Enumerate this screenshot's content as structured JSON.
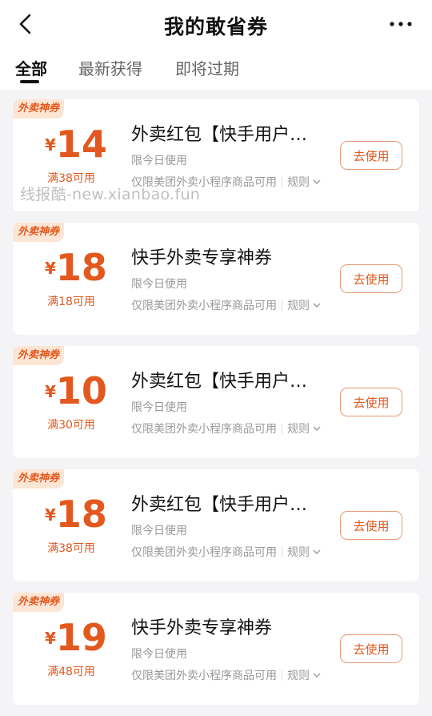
{
  "header": {
    "title": "我的敢省券"
  },
  "tabs": [
    {
      "label": "全部",
      "active": true
    },
    {
      "label": "最新获得",
      "active": false
    },
    {
      "label": "即将过期",
      "active": false
    }
  ],
  "coupons": [
    {
      "tag": "外卖神券",
      "currency": "¥",
      "amount": "14",
      "condition": "满38可用",
      "title": "外卖红包【快手用户专享】",
      "validity": "限今日使用",
      "scope": "仅限美团外卖小程序商品可用",
      "rule_label": "规则",
      "button": "去使用"
    },
    {
      "tag": "外卖神券",
      "currency": "¥",
      "amount": "18",
      "condition": "满18可用",
      "title": "快手外卖专享神券",
      "validity": "限今日使用",
      "scope": "仅限美团外卖小程序商品可用",
      "rule_label": "规则",
      "button": "去使用"
    },
    {
      "tag": "外卖神券",
      "currency": "¥",
      "amount": "10",
      "condition": "满30可用",
      "title": "外卖红包【快手用户专享】",
      "validity": "限今日使用",
      "scope": "仅限美团外卖小程序商品可用",
      "rule_label": "规则",
      "button": "去使用"
    },
    {
      "tag": "外卖神券",
      "currency": "¥",
      "amount": "18",
      "condition": "满38可用",
      "title": "外卖红包【快手用户专享】",
      "validity": "限今日使用",
      "scope": "仅限美团外卖小程序商品可用",
      "rule_label": "规则",
      "button": "去使用"
    },
    {
      "tag": "外卖神券",
      "currency": "¥",
      "amount": "19",
      "condition": "满48可用",
      "title": "快手外卖专享神券",
      "validity": "限今日使用",
      "scope": "仅限美团外卖小程序商品可用",
      "rule_label": "规则",
      "button": "去使用"
    }
  ],
  "watermark": "线报酷-new.xianbao.fun",
  "colors": {
    "accent": "#e2581e",
    "tag_bg": "#fde5d4",
    "page_bg": "#f4f4f6"
  },
  "icons": {
    "back": "chevron-left-icon",
    "more": "more-dots-icon",
    "rule": "chevron-down-icon"
  }
}
